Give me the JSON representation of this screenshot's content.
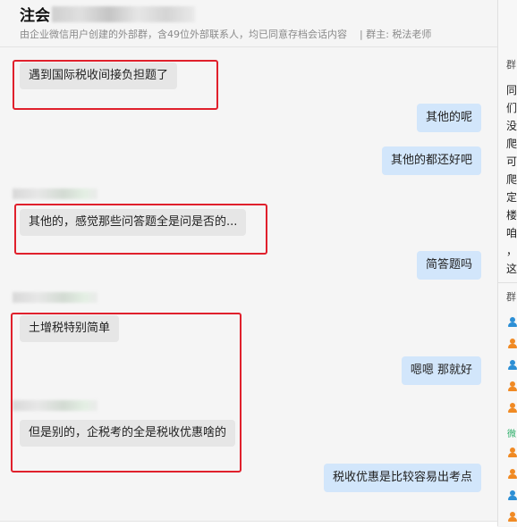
{
  "header": {
    "title_prefix": "注会",
    "subtitle": "由企业微信用户创建的外部群，含49位外部联系人，均已同意存档会话内容",
    "owner": "| 群主: 税法老师"
  },
  "messages": [
    {
      "side": "in",
      "text": "遇到国际税收间接负担题了"
    },
    {
      "side": "out",
      "text": "其他的呢"
    },
    {
      "side": "out",
      "text": "其他的都还好吧"
    },
    {
      "side": "in",
      "text": "其他的，感觉那些问答题全是问是否的..."
    },
    {
      "side": "out",
      "text": "简答题吗"
    },
    {
      "side": "in",
      "text": "土增税特别简单"
    },
    {
      "side": "out",
      "text": "嗯嗯 那就好"
    },
    {
      "side": "in",
      "text": "但是别的，企税考的全是税收优惠啥的"
    },
    {
      "side": "out",
      "text": "税收优惠是比较容易出考点"
    }
  ],
  "side_panel": {
    "notice_label": "群",
    "notice_chars": [
      "同",
      "们",
      "没",
      "爬",
      "可",
      "爬",
      "定",
      "楼",
      "咱",
      "，",
      "这"
    ],
    "members_label": "群",
    "wechat_tag": "微",
    "member_icon_colors": [
      "#2d8fd5",
      "#f08a24",
      "#2d8fd5",
      "#f08a24",
      "#f08a24",
      "#f08a24",
      "#f08a24",
      "#2d8fd5",
      "#f08a24"
    ]
  }
}
